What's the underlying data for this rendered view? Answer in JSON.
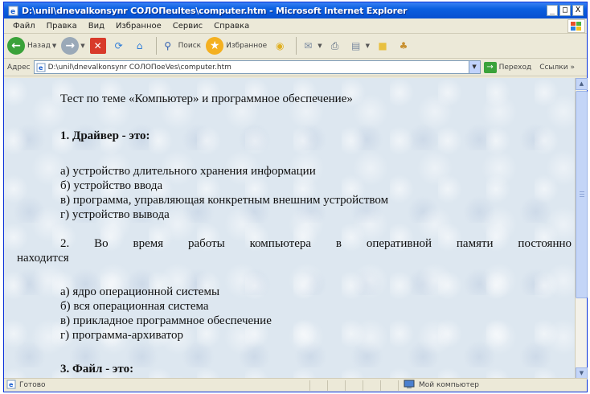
{
  "window": {
    "title": "D:\\unil\\dnevalkonsynr COЛOПeultes\\computer.htm - Microsoft Internet Explorer",
    "min_label": "_",
    "max_label": "□",
    "close_label": "X"
  },
  "menu": {
    "items": [
      "Файл",
      "Правка",
      "Вид",
      "Избранное",
      "Сервис",
      "Справка"
    ]
  },
  "toolbar": {
    "back_label": "Назад",
    "search_label": "Поиск",
    "favorites_label": "Избранное"
  },
  "addressbar": {
    "label": "Адрес",
    "url": "D:\\unil\\dnevalkonsynr COЛOПoeVes\\computer.htm",
    "go_label": "Переход",
    "links_label": "Ссылки »"
  },
  "content": {
    "heading": "Тест по теме «Компьютер» и программное обеспечение»",
    "q1": "1. Драйвер - это:",
    "q1_options": [
      "а) устройство длительного хранения информации",
      "б) устройство ввода",
      "в) программа, управляющая конкретным внешним устройством",
      "г) устройство вывода"
    ],
    "q2_line1": "2. Во время работы компьютера в оперативной памяти постоянно",
    "q2_line2": "находится",
    "q2_options": [
      "а) ядро операционной системы",
      "б) вся операционная система",
      "в) прикладное программное обеспечение",
      "г) программа-архиватор"
    ],
    "q3": "3. Файл - это:"
  },
  "statusbar": {
    "left": "Готово",
    "zone": "Мой компьютер"
  },
  "colors": {
    "titlebar": "#0a5fe0",
    "page_bg": "#dde7f0",
    "chrome": "#ece9d8"
  }
}
